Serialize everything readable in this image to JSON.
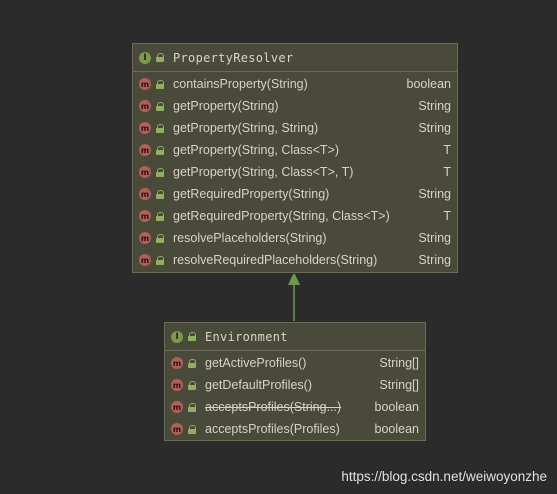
{
  "diagram": {
    "interfaces": [
      {
        "id": "box-resolver",
        "icon_label": "I",
        "name": "PropertyResolver",
        "methods": [
          {
            "signature": "containsProperty(String)",
            "return_type": "boolean",
            "deprecated": false
          },
          {
            "signature": "getProperty(String)",
            "return_type": "String",
            "deprecated": false
          },
          {
            "signature": "getProperty(String, String)",
            "return_type": "String",
            "deprecated": false
          },
          {
            "signature": "getProperty(String, Class<T>)",
            "return_type": "T",
            "deprecated": false
          },
          {
            "signature": "getProperty(String, Class<T>, T)",
            "return_type": "T",
            "deprecated": false
          },
          {
            "signature": "getRequiredProperty(String)",
            "return_type": "String",
            "deprecated": false
          },
          {
            "signature": "getRequiredProperty(String, Class<T>)",
            "return_type": "T",
            "deprecated": false
          },
          {
            "signature": "resolvePlaceholders(String)",
            "return_type": "String",
            "deprecated": false
          },
          {
            "signature": "resolveRequiredPlaceholders(String)",
            "return_type": "String",
            "deprecated": false
          }
        ]
      },
      {
        "id": "box-env",
        "icon_label": "I",
        "name": "Environment",
        "methods": [
          {
            "signature": "getActiveProfiles()",
            "return_type": "String[]",
            "deprecated": false
          },
          {
            "signature": "getDefaultProfiles()",
            "return_type": "String[]",
            "deprecated": false
          },
          {
            "signature": "acceptsProfiles(String...)",
            "return_type": "boolean",
            "deprecated": true
          },
          {
            "signature": "acceptsProfiles(Profiles)",
            "return_type": "boolean",
            "deprecated": false
          }
        ]
      }
    ],
    "relations": [
      {
        "from": "Environment",
        "to": "PropertyResolver",
        "type": "extends"
      }
    ],
    "method_icon_label": "m",
    "colors": {
      "interface_icon": "#7c9a4a",
      "method_icon": "#b35e5a",
      "arrow": "#6a9a4a",
      "box_fill": "#4a4a3a",
      "background": "#2b2b2b"
    }
  },
  "watermark": "https://blog.csdn.net/weiwoyonzhe"
}
